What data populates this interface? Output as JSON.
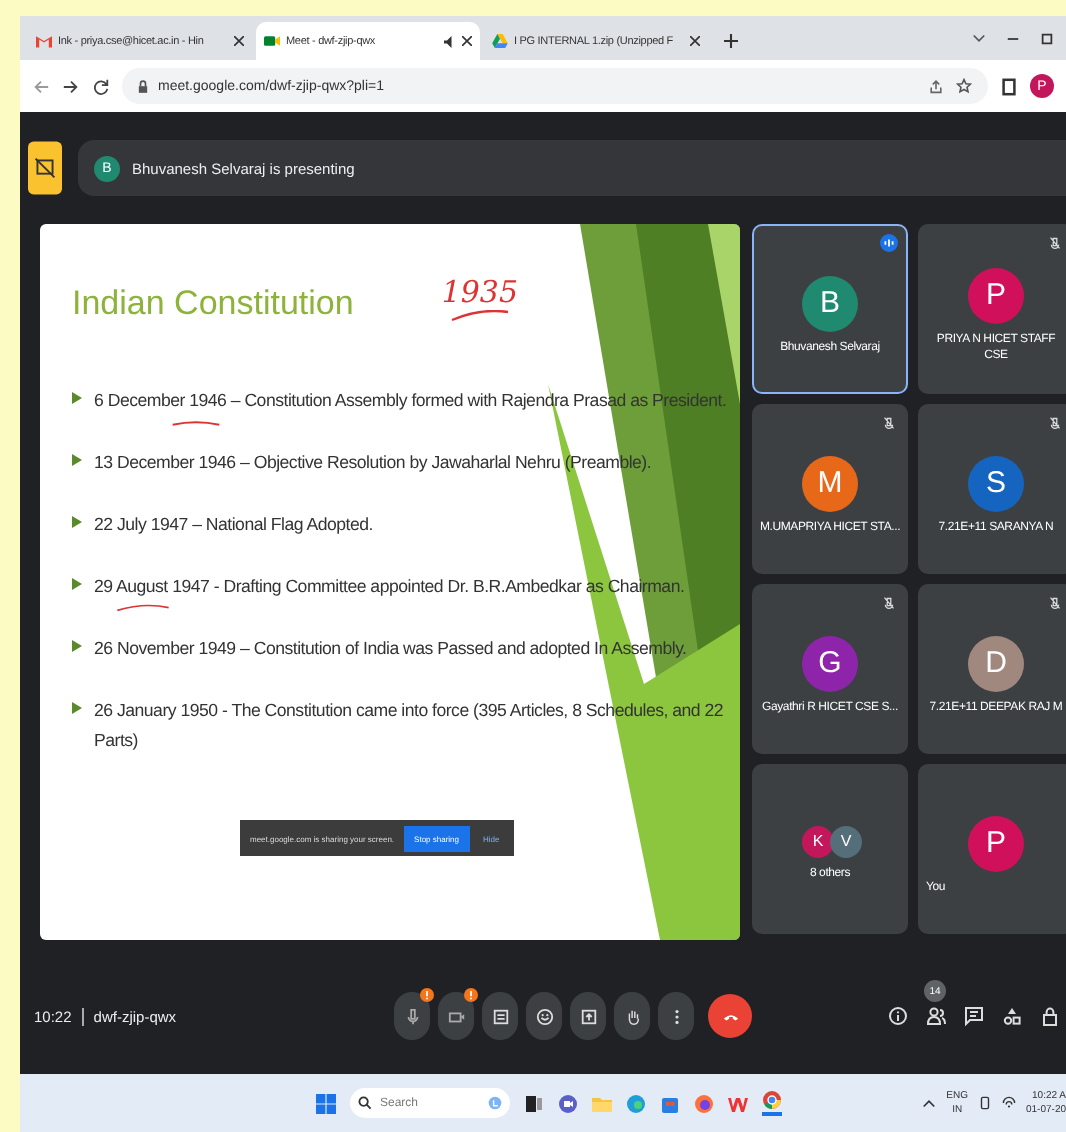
{
  "browser": {
    "tabs": [
      {
        "kind": "mail",
        "title": "Ink - priya.cse@hicet.ac.in - Hin",
        "selected": false,
        "playing_audio": false
      },
      {
        "kind": "meet",
        "title": "Meet - dwf-zjip-qwx",
        "selected": true,
        "playing_audio": true
      },
      {
        "kind": "drive",
        "title": "I PG INTERNAL 1.zip (Unzipped F",
        "selected": false,
        "playing_audio": false
      }
    ],
    "address": "meet.google.com/dwf-zjip-qwx?pli=1",
    "profile_initial": "P"
  },
  "meet": {
    "banner": {
      "initial": "B",
      "text": "Bhuvanesh Selvaraj is presenting"
    },
    "slide": {
      "title": "Indian Constitution",
      "annotation": "1935",
      "bullets": [
        "6 December 1946 – Constitution Assembly formed with Rajendra Prasad as President.",
        "13 December 1946 – Objective Resolution by Jawaharlal Nehru (Preamble).",
        "22 July 1947 – National Flag Adopted.",
        "29 August 1947 - Drafting Committee appointed Dr. B.R.Ambedkar as Chairman.",
        "26 November 1949 – Constitution of India was Passed and adopted In Assembly.",
        "26 January 1950 - The Constitution came into force (395 Articles, 8 Schedules, and 22 Parts)"
      ]
    },
    "share_notice": {
      "text": "meet.google.com is sharing your screen.",
      "buttons": [
        "Stop sharing",
        "Hide"
      ]
    },
    "tiles": [
      {
        "kind": "person",
        "name": "Bhuvanesh Selvaraj",
        "initial": "B",
        "color": "#1f8a70",
        "speaking": true,
        "muted": false
      },
      {
        "kind": "person",
        "name": "PRIYA N HICET STAFF CSE",
        "initial": "P",
        "color": "#d0105a",
        "speaking": false,
        "muted": true
      },
      {
        "kind": "person",
        "name": "M.UMAPRIYA HICET STA...",
        "initial": "M",
        "color": "#e8681a",
        "speaking": false,
        "muted": true
      },
      {
        "kind": "person",
        "name": "7.21E+11 SARANYA N",
        "initial": "S",
        "color": "#1565c0",
        "speaking": false,
        "muted": true
      },
      {
        "kind": "person",
        "name": "Gayathri R HICET CSE S...",
        "initial": "G",
        "color": "#8e24aa",
        "speaking": false,
        "muted": true
      },
      {
        "kind": "person",
        "name": "7.21E+11 DEEPAK RAJ M",
        "initial": "D",
        "color": "#a1887f",
        "speaking": false,
        "muted": true
      },
      {
        "kind": "group",
        "name": "8 others",
        "avatars": [
          {
            "initial": "K",
            "color": "#c2185b"
          },
          {
            "initial": "V",
            "color": "#546e7a"
          }
        ]
      },
      {
        "kind": "person",
        "name": "You",
        "initial": "P",
        "color": "#d0105a",
        "speaking": false,
        "muted": false
      }
    ],
    "meeting_time": "10:22",
    "meeting_code": "dwf-zjip-qwx",
    "participants_count": "14"
  },
  "taskbar": {
    "search_placeholder": "Search",
    "language": "ENG",
    "region": "IN",
    "time": "10:22 A",
    "date": "01-07-20"
  }
}
